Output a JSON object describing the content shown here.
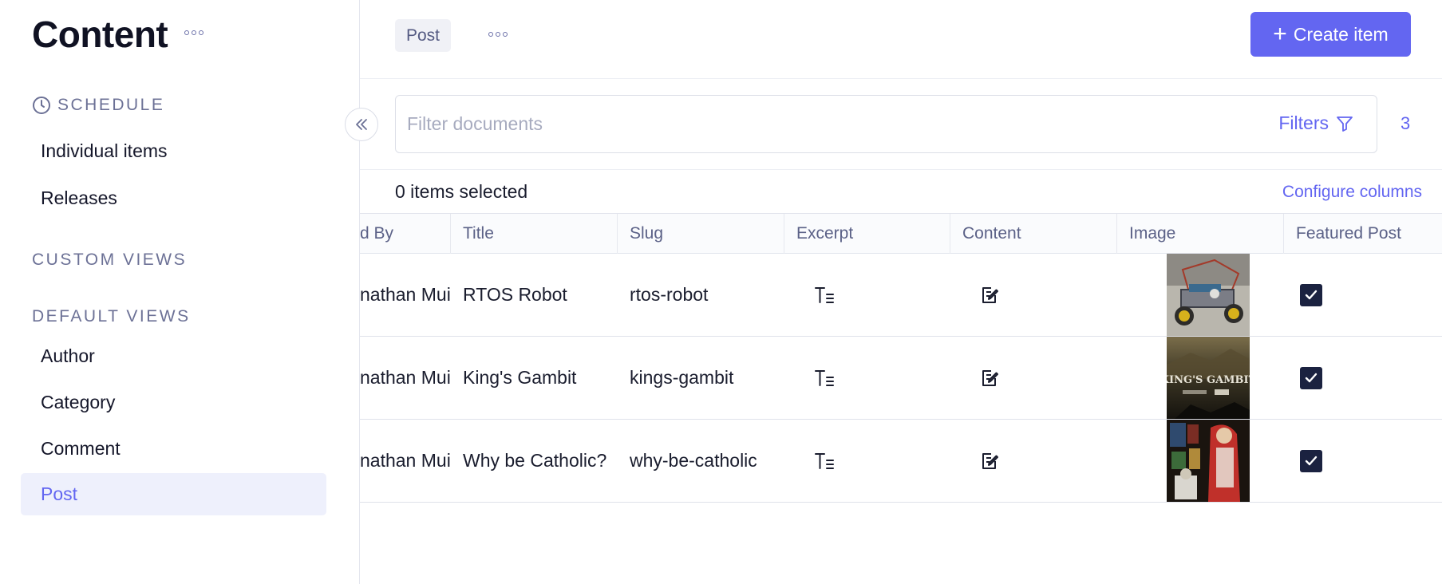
{
  "sidebar": {
    "title": "Content",
    "schedule_label": "SCHEDULE",
    "schedule_items": [
      "Individual items",
      "Releases"
    ],
    "custom_views_label": "CUSTOM VIEWS",
    "default_views_label": "DEFAULT VIEWS",
    "default_items": [
      "Author",
      "Category",
      "Comment",
      "Post"
    ],
    "active_item": "Post"
  },
  "topbar": {
    "tab": "Post",
    "create_label": "Create item"
  },
  "filter": {
    "placeholder": "Filter documents",
    "filters_label": "Filters",
    "count": "3"
  },
  "selection": {
    "text": "0 items selected",
    "configure_label": "Configure columns"
  },
  "table": {
    "columns": [
      "d By",
      "Title",
      "Slug",
      "Excerpt",
      "Content",
      "Image",
      "Featured Post"
    ],
    "rows": [
      {
        "author": "nathan Mui",
        "title": "RTOS Robot",
        "slug": "rtos-robot",
        "image": "robot car photo",
        "featured": true
      },
      {
        "author": "nathan Mui",
        "title": "King's Gambit",
        "slug": "kings-gambit",
        "image": "KING'S GAMBIT",
        "featured": true
      },
      {
        "author": "nathan Mui",
        "title": "Why be Catholic?",
        "slug": "why-be-catholic",
        "image": "stained glass photo",
        "featured": true
      }
    ]
  },
  "colors": {
    "accent": "#6366f1",
    "checkbox": "#1b2240",
    "muted": "#6c7196"
  }
}
